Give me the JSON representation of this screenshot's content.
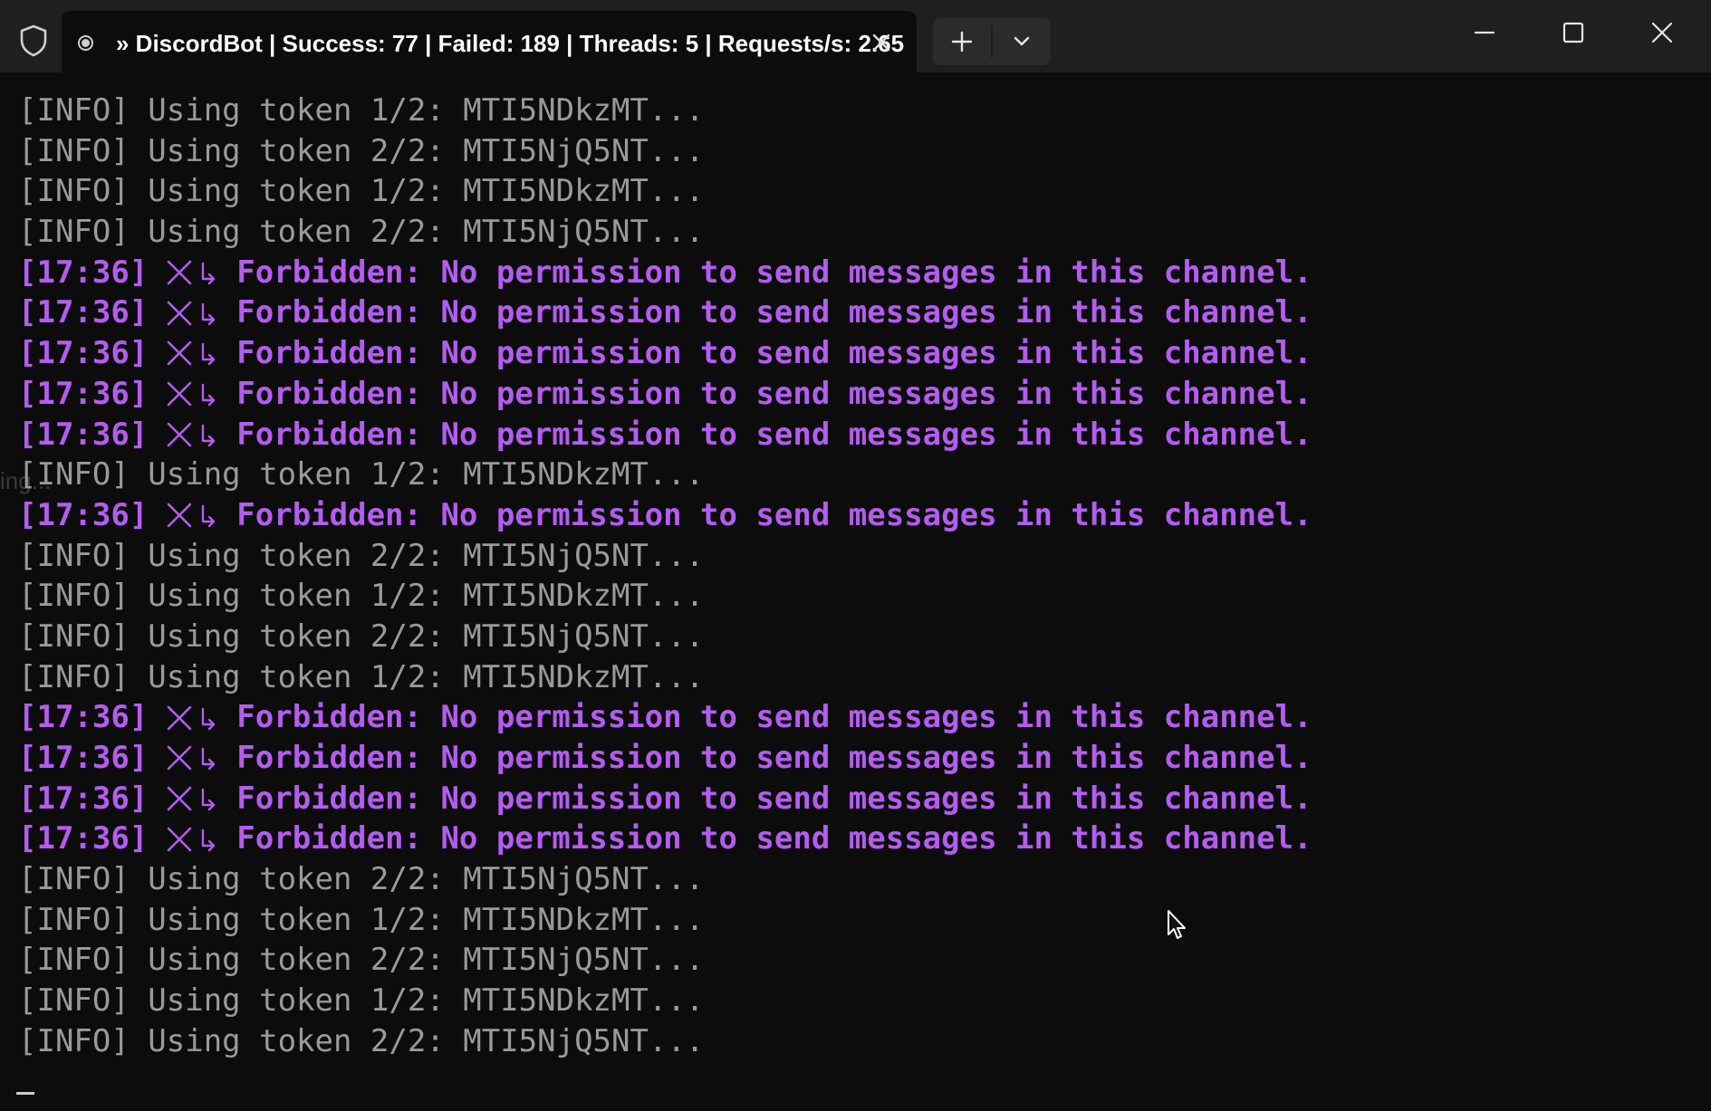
{
  "window": {
    "tab_title": "» DiscordBot | Success: 77 | Failed: 189 | Threads: 5 | Requests/s: 2.65",
    "icons": {
      "shield": "shield-icon",
      "tab_status": "record-dot-icon",
      "tab_close": "close-icon",
      "new_tab": "plus-icon",
      "dropdown": "chevron-down-icon",
      "minimize": "minimize-icon",
      "maximize": "maximize-icon",
      "close": "close-icon"
    }
  },
  "colors": {
    "background": "#0c0c0c",
    "titlebar": "#1f1f1f",
    "info_text": "#9a9a9a",
    "error_text": "#b45cf0"
  },
  "terminal": {
    "ghost_text": "ing...",
    "lines": [
      {
        "type": "info",
        "text": "[INFO] Using token 1/2: MTI5NDkzMT..."
      },
      {
        "type": "info",
        "text": "[INFO] Using token 2/2: MTI5NjQ5NT..."
      },
      {
        "type": "info",
        "text": "[INFO] Using token 1/2: MTI5NDkzMT..."
      },
      {
        "type": "info",
        "text": "[INFO] Using token 2/2: MTI5NjQ5NT..."
      },
      {
        "type": "error",
        "time": "[17:36]",
        "text": "Forbidden: No permission to send messages in this channel."
      },
      {
        "type": "error",
        "time": "[17:36]",
        "text": "Forbidden: No permission to send messages in this channel."
      },
      {
        "type": "error",
        "time": "[17:36]",
        "text": "Forbidden: No permission to send messages in this channel."
      },
      {
        "type": "error",
        "time": "[17:36]",
        "text": "Forbidden: No permission to send messages in this channel."
      },
      {
        "type": "error",
        "time": "[17:36]",
        "text": "Forbidden: No permission to send messages in this channel."
      },
      {
        "type": "info",
        "text": "[INFO] Using token 1/2: MTI5NDkzMT..."
      },
      {
        "type": "error",
        "time": "[17:36]",
        "text": "Forbidden: No permission to send messages in this channel."
      },
      {
        "type": "info",
        "text": "[INFO] Using token 2/2: MTI5NjQ5NT..."
      },
      {
        "type": "info",
        "text": "[INFO] Using token 1/2: MTI5NDkzMT..."
      },
      {
        "type": "info",
        "text": "[INFO] Using token 2/2: MTI5NjQ5NT..."
      },
      {
        "type": "info",
        "text": "[INFO] Using token 1/2: MTI5NDkzMT..."
      },
      {
        "type": "error",
        "time": "[17:36]",
        "text": "Forbidden: No permission to send messages in this channel."
      },
      {
        "type": "error",
        "time": "[17:36]",
        "text": "Forbidden: No permission to send messages in this channel."
      },
      {
        "type": "error",
        "time": "[17:36]",
        "text": "Forbidden: No permission to send messages in this channel."
      },
      {
        "type": "error",
        "time": "[17:36]",
        "text": "Forbidden: No permission to send messages in this channel."
      },
      {
        "type": "info",
        "text": "[INFO] Using token 2/2: MTI5NjQ5NT..."
      },
      {
        "type": "info",
        "text": "[INFO] Using token 1/2: MTI5NDkzMT..."
      },
      {
        "type": "info",
        "text": "[INFO] Using token 2/2: MTI5NjQ5NT..."
      },
      {
        "type": "info",
        "text": "[INFO] Using token 1/2: MTI5NDkzMT..."
      },
      {
        "type": "info",
        "text": "[INFO] Using token 2/2: MTI5NjQ5NT..."
      }
    ]
  }
}
